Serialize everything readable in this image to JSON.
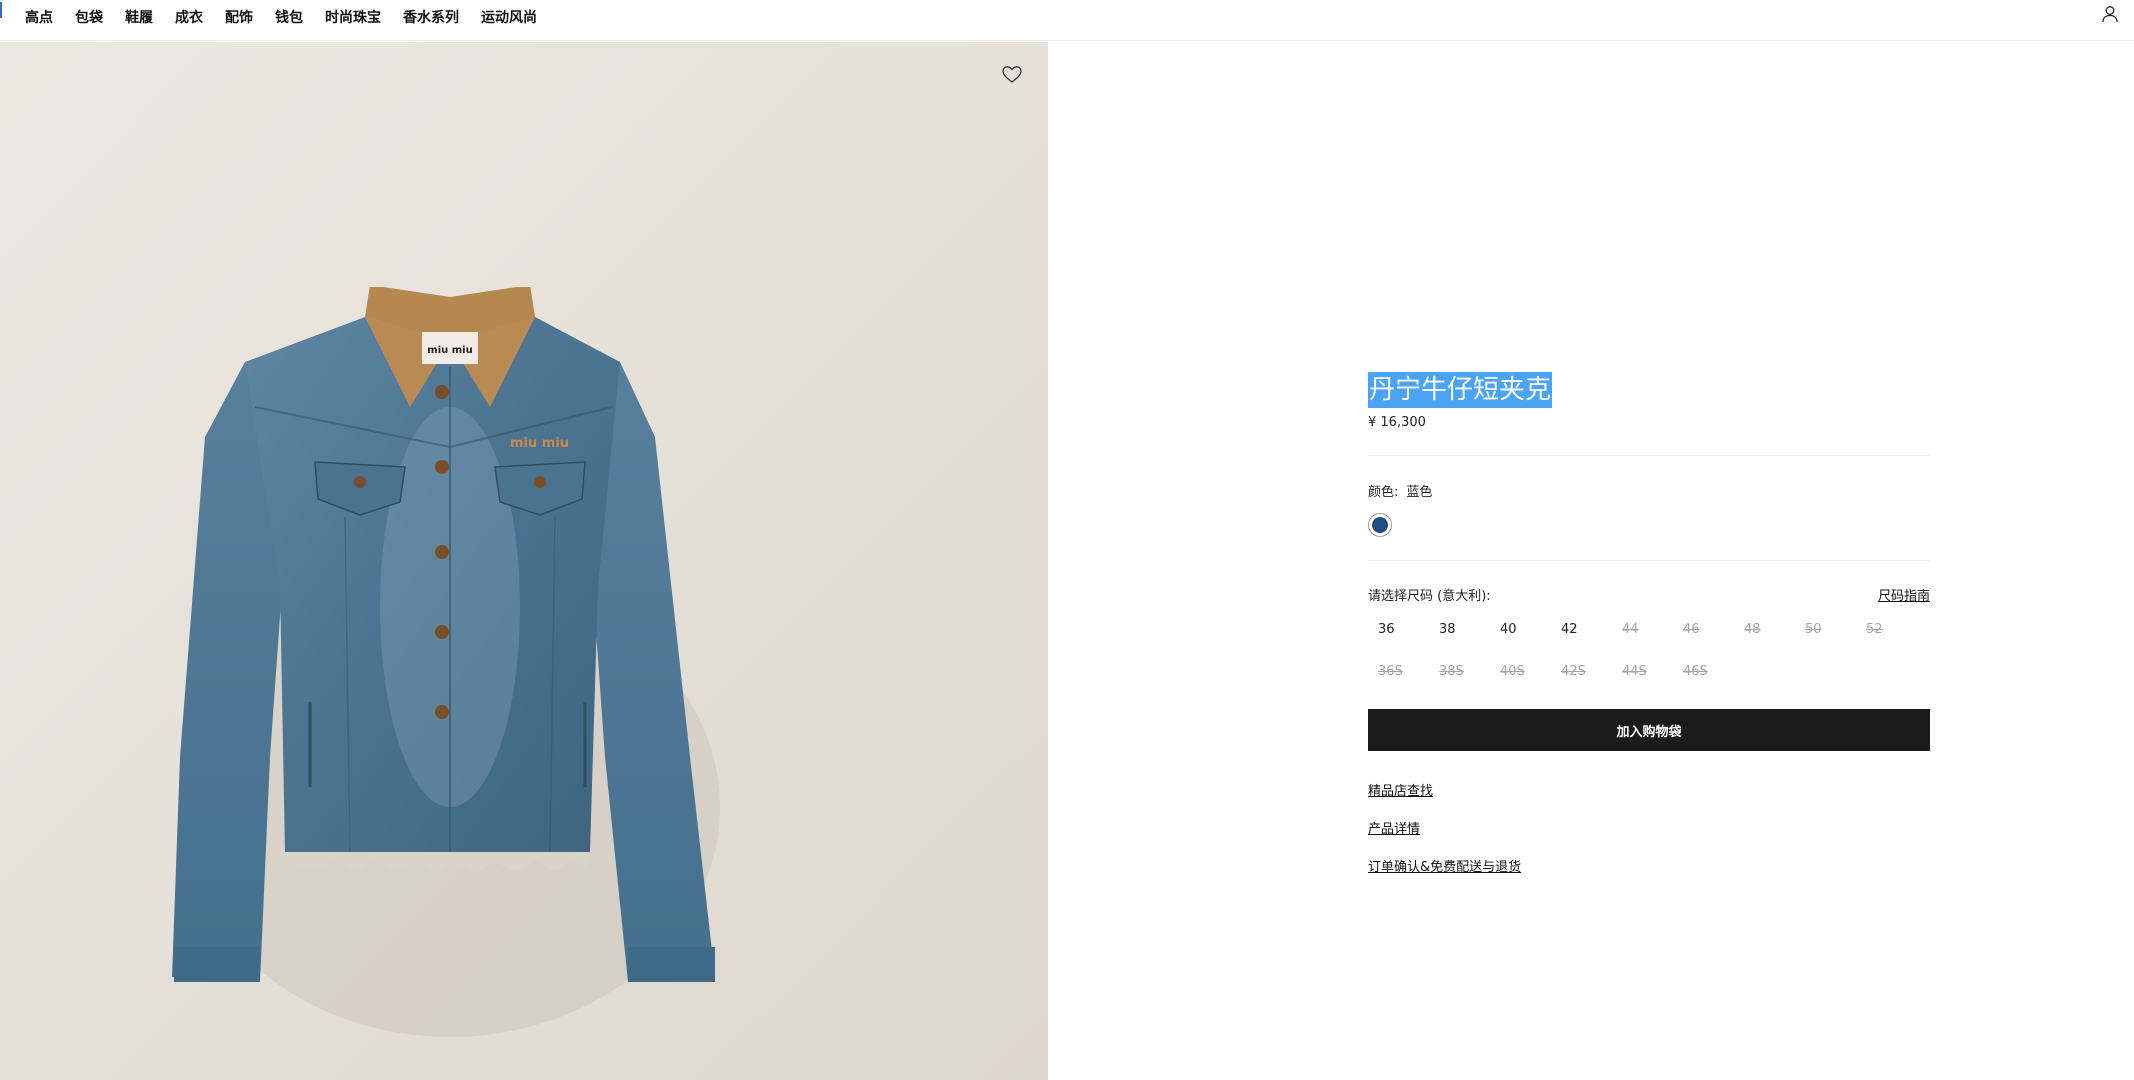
{
  "nav": {
    "items": [
      "高点",
      "包袋",
      "鞋履",
      "成衣",
      "配饰",
      "钱包",
      "时尚珠宝",
      "香水系列",
      "运动风尚"
    ]
  },
  "product": {
    "image_brand_labels": [
      "miu miu",
      "miu miu"
    ],
    "title": "丹宁牛仔短夹克",
    "price": "¥ 16,300",
    "color_label": "颜色:",
    "color_value": "蓝色",
    "swatch_color": "#1e4f84",
    "size_label": "请选择尺码 (意大利):",
    "size_guide": "尺码指南",
    "sizes_row1": [
      {
        "label": "36",
        "available": true
      },
      {
        "label": "38",
        "available": true
      },
      {
        "label": "40",
        "available": true
      },
      {
        "label": "42",
        "available": true
      },
      {
        "label": "44",
        "available": false
      },
      {
        "label": "46",
        "available": false
      },
      {
        "label": "48",
        "available": false
      },
      {
        "label": "50",
        "available": false
      },
      {
        "label": "52",
        "available": false
      }
    ],
    "sizes_row2": [
      {
        "label": "36S",
        "available": false
      },
      {
        "label": "38S",
        "available": false
      },
      {
        "label": "40S",
        "available": false
      },
      {
        "label": "42S",
        "available": false
      },
      {
        "label": "44S",
        "available": false
      },
      {
        "label": "46S",
        "available": false
      }
    ],
    "add_to_bag": "加入购物袋",
    "links": [
      "精品店查找",
      "产品详情",
      "订单确认&免费配送与退货"
    ]
  },
  "icons": {
    "favorite": "heart-outline-icon",
    "account": "user-icon"
  }
}
